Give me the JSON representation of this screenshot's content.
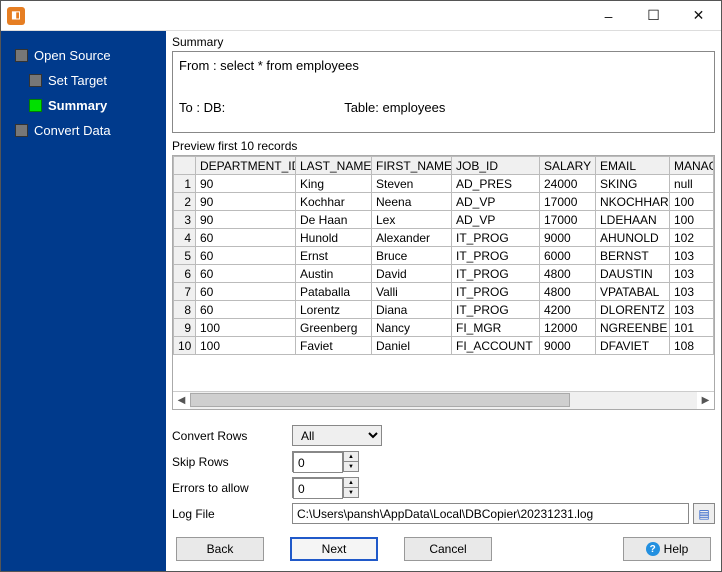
{
  "window": {
    "minimize": "–",
    "maximize": "☐",
    "close": "✕"
  },
  "sidebar": {
    "items": [
      {
        "label": "Open Source",
        "indent": false,
        "current": false
      },
      {
        "label": "Set Target",
        "indent": true,
        "current": false
      },
      {
        "label": "Summary",
        "indent": true,
        "current": true
      },
      {
        "label": "Convert Data",
        "indent": false,
        "current": false
      }
    ]
  },
  "summary": {
    "section_label": "Summary",
    "text": "From : select * from employees\n\nTo : DB:                                 Table: employees"
  },
  "preview": {
    "section_label": "Preview first 10 records",
    "columns": [
      "DEPARTMENT_ID",
      "LAST_NAME",
      "FIRST_NAME",
      "JOB_ID",
      "SALARY",
      "EMAIL",
      "MANAG"
    ],
    "rows": [
      [
        "90",
        "King",
        "Steven",
        "AD_PRES",
        "24000",
        "SKING",
        "null"
      ],
      [
        "90",
        "Kochhar",
        "Neena",
        "AD_VP",
        "17000",
        "NKOCHHAR",
        "100"
      ],
      [
        "90",
        "De Haan",
        "Lex",
        "AD_VP",
        "17000",
        "LDEHAAN",
        "100"
      ],
      [
        "60",
        "Hunold",
        "Alexander",
        "IT_PROG",
        "9000",
        "AHUNOLD",
        "102"
      ],
      [
        "60",
        "Ernst",
        "Bruce",
        "IT_PROG",
        "6000",
        "BERNST",
        "103"
      ],
      [
        "60",
        "Austin",
        "David",
        "IT_PROG",
        "4800",
        "DAUSTIN",
        "103"
      ],
      [
        "60",
        "Pataballa",
        "Valli",
        "IT_PROG",
        "4800",
        "VPATABAL",
        "103"
      ],
      [
        "60",
        "Lorentz",
        "Diana",
        "IT_PROG",
        "4200",
        "DLORENTZ",
        "103"
      ],
      [
        "100",
        "Greenberg",
        "Nancy",
        "FI_MGR",
        "12000",
        "NGREENBE",
        "101"
      ],
      [
        "100",
        "Faviet",
        "Daniel",
        "FI_ACCOUNT",
        "9000",
        "DFAVIET",
        "108"
      ]
    ]
  },
  "form": {
    "convert_rows_label": "Convert Rows",
    "convert_rows_value": "All",
    "skip_rows_label": "Skip Rows",
    "skip_rows_value": "0",
    "errors_label": "Errors to allow",
    "errors_value": "0",
    "logfile_label": "Log File",
    "logfile_value": "C:\\Users\\pansh\\AppData\\Local\\DBCopier\\20231231.log"
  },
  "buttons": {
    "back": "Back",
    "next": "Next",
    "cancel": "Cancel",
    "help": "Help"
  }
}
